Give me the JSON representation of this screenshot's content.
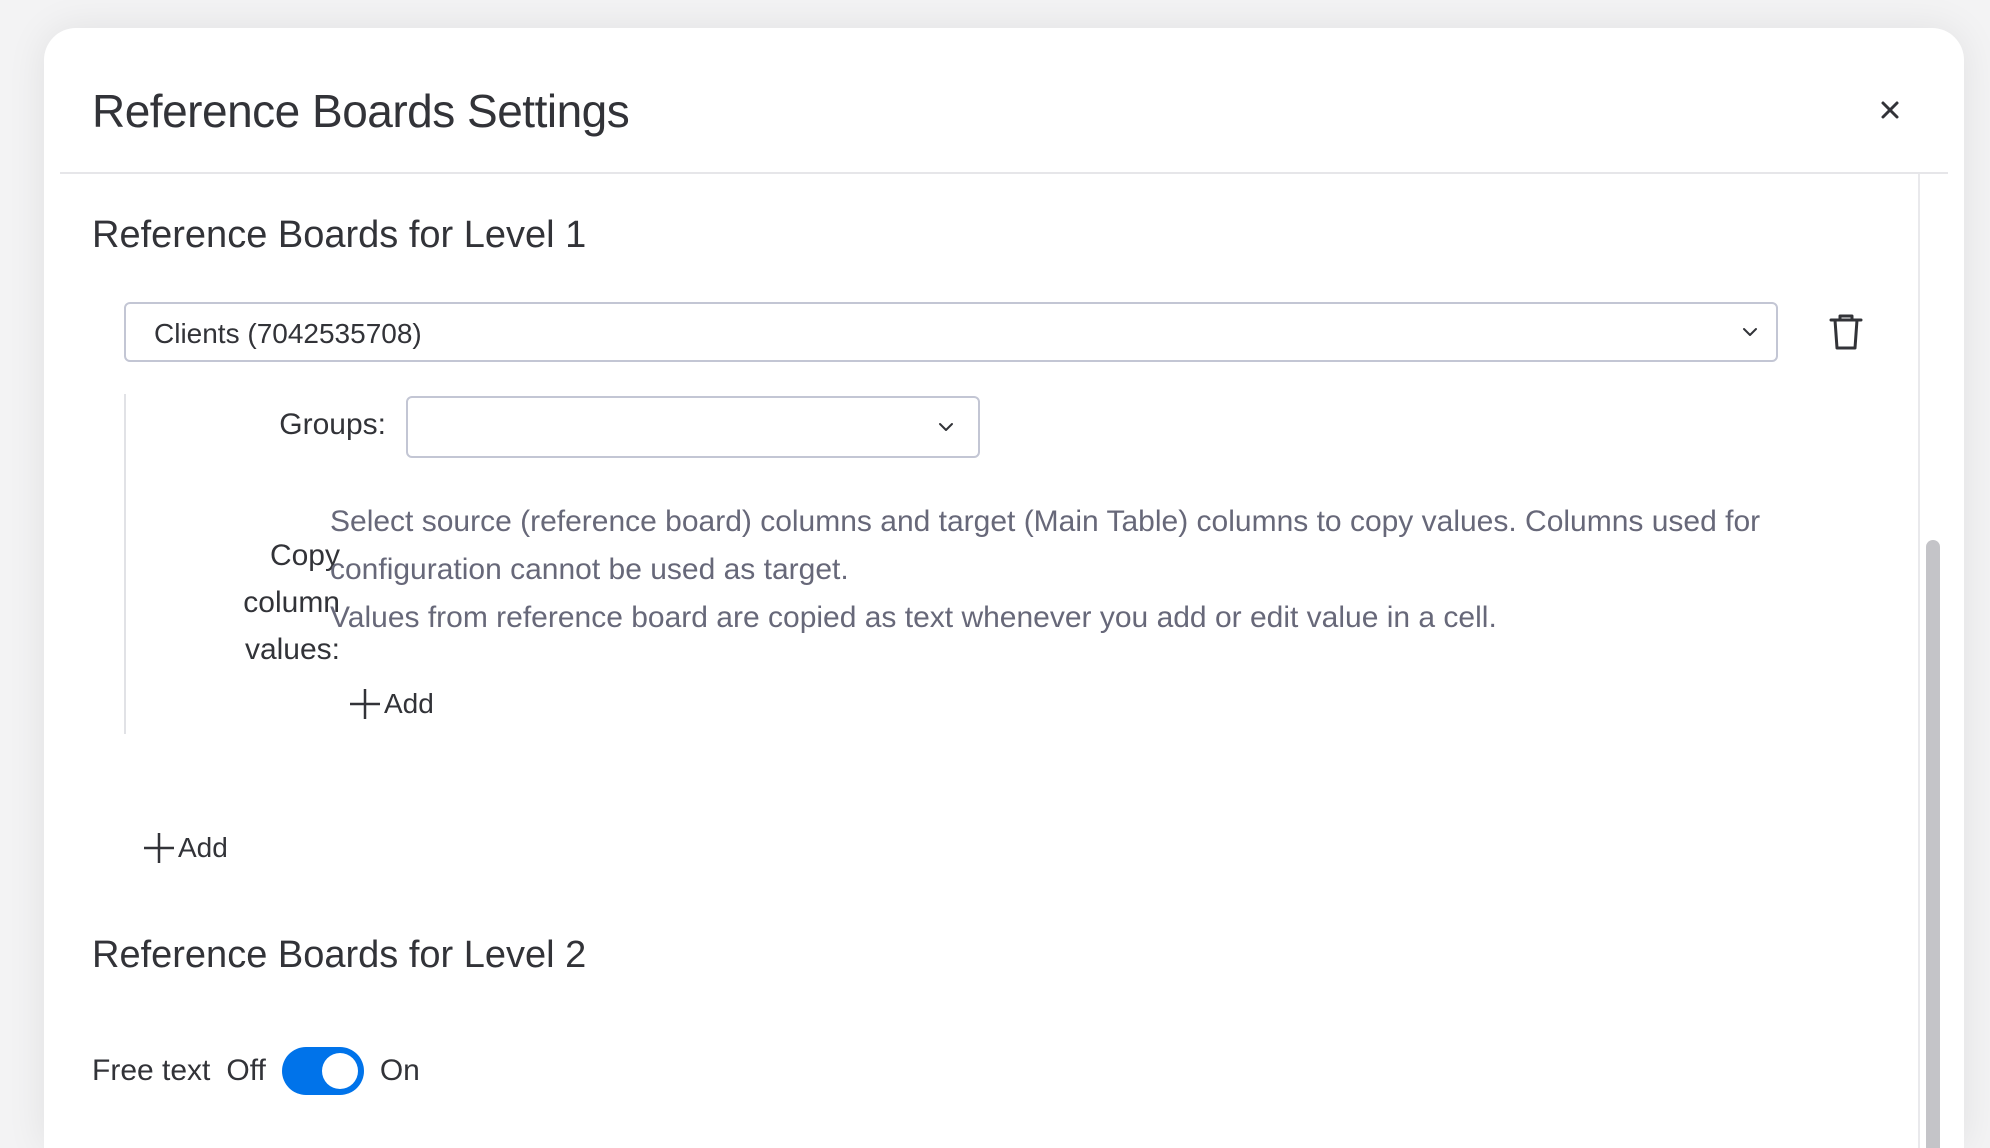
{
  "dialog": {
    "title": "Reference Boards Settings"
  },
  "level1": {
    "title": "Reference Boards for Level 1",
    "board_select_value": "Clients (7042535708)",
    "groups_label": "Groups:",
    "groups_value": "",
    "copy_label": "Copy column values:",
    "copy_description_line1": "Select source (reference board) columns and target (Main Table) columns to copy values. Columns used for configuration cannot be used as target.",
    "copy_description_line2": "Values from reference board are copied as text whenever you add or edit value in a cell.",
    "copy_add_label": "Add",
    "board_add_label": "Add"
  },
  "level2": {
    "title": "Reference Boards for Level 2",
    "free_text_label": "Free text",
    "toggle_off_label": "Off",
    "toggle_on_label": "On",
    "toggle_state": "on"
  },
  "colors": {
    "accent": "#0073ea",
    "text": "#323338",
    "secondary_text": "#676879",
    "border": "#c3c6d4"
  },
  "icons": {
    "close": "close-icon",
    "chevron": "chevron-down-icon",
    "trash": "trash-icon",
    "plus": "plus-icon"
  }
}
